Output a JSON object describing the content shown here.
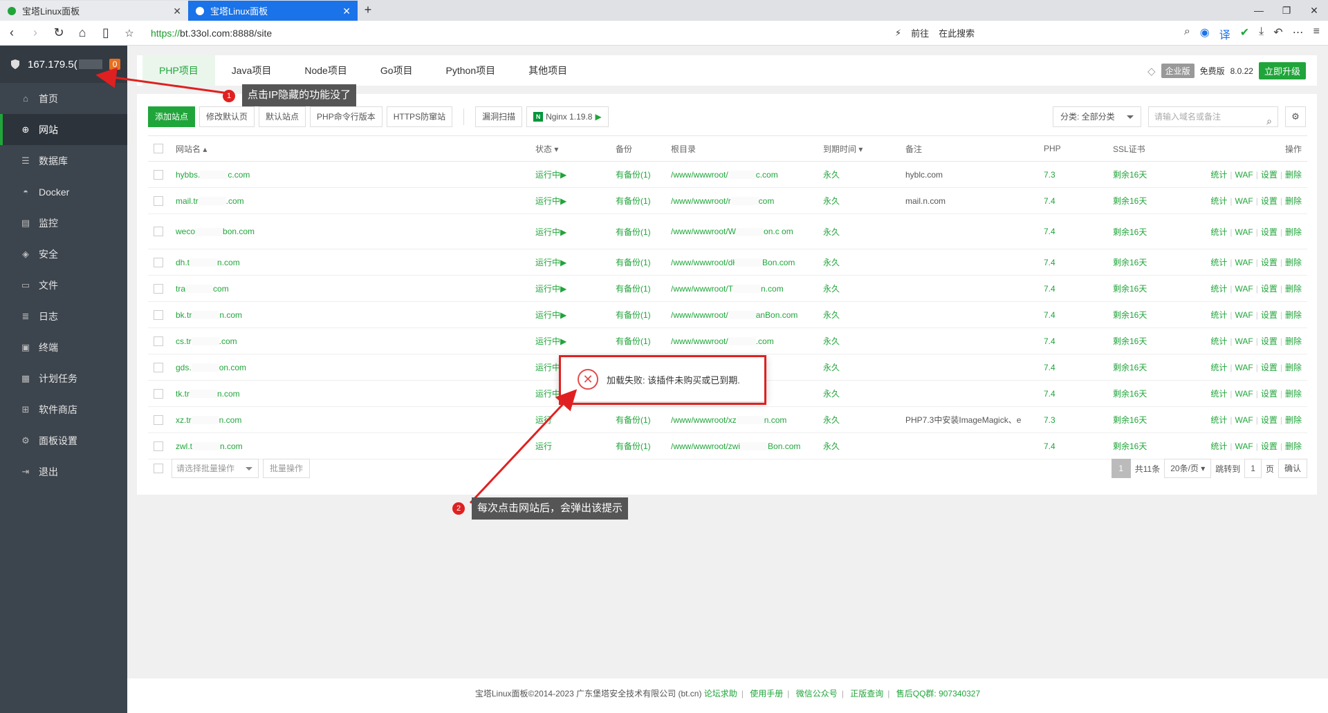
{
  "browser": {
    "tabs": [
      {
        "title": "宝塔Linux面板",
        "active": false
      },
      {
        "title": "宝塔Linux面板",
        "active": true
      }
    ],
    "url_scheme": "https://",
    "url_rest": "bt.33ol.com:8888/site",
    "go_label": "前往",
    "search_label": "在此搜索"
  },
  "sidebar": {
    "server_ip": "167.179.5(",
    "badge": "0",
    "items": [
      {
        "label": "首页",
        "icon": "home-icon"
      },
      {
        "label": "网站",
        "icon": "globe-icon",
        "active": true
      },
      {
        "label": "数据库",
        "icon": "database-icon"
      },
      {
        "label": "Docker",
        "icon": "docker-icon"
      },
      {
        "label": "监控",
        "icon": "monitor-icon"
      },
      {
        "label": "安全",
        "icon": "shield-icon"
      },
      {
        "label": "文件",
        "icon": "folder-icon"
      },
      {
        "label": "日志",
        "icon": "log-icon"
      },
      {
        "label": "终端",
        "icon": "terminal-icon"
      },
      {
        "label": "计划任务",
        "icon": "calendar-icon"
      },
      {
        "label": "软件商店",
        "icon": "grid-icon"
      },
      {
        "label": "面板设置",
        "icon": "gear-icon"
      },
      {
        "label": "退出",
        "icon": "logout-icon"
      }
    ]
  },
  "project_tabs": [
    "PHP项目",
    "Java项目",
    "Node项目",
    "Go项目",
    "Python项目",
    "其他项目"
  ],
  "header_right": {
    "enterprise": "企业版",
    "free": "免费版",
    "version": "8.0.22",
    "upgrade": "立即升级"
  },
  "toolbar": {
    "add_site": "添加站点",
    "edit_default_page": "修改默认页",
    "default_site": "默认站点",
    "php_cli_version": "PHP命令行版本",
    "https_guard": "HTTPS防窜站",
    "vuln_scan": "漏洞扫描",
    "nginx": "Nginx 1.19.8",
    "category": "分类: 全部分类",
    "search_placeholder": "请输入域名或备注"
  },
  "table": {
    "headers": {
      "name": "网站名",
      "status": "状态",
      "backup": "备份",
      "root": "根目录",
      "expire": "到期时间",
      "remark": "备注",
      "php": "PHP",
      "ssl": "SSL证书",
      "ops": "操作"
    },
    "ops": [
      "统计",
      "WAF",
      "设置",
      "删除"
    ],
    "rows": [
      {
        "name_a": "hybbs.",
        "name_b": "c.com",
        "status": "运行中▶",
        "backup": "有备份(1)",
        "root_a": "/www/wwwroot/",
        "root_b": "c.com",
        "expire": "永久",
        "remark_a": "hybl",
        "remark_b": "c.com",
        "php": "7.3",
        "ssl": "剩余16天"
      },
      {
        "name_a": "mail.tr",
        "name_b": ".com",
        "status": "运行中▶",
        "backup": "有备份(1)",
        "root_a": "/www/wwwroot/r",
        "root_b": "com",
        "expire": "永久",
        "remark_a": "mail.",
        "remark_b": "n.com",
        "php": "7.4",
        "ssl": "剩余16天"
      },
      {
        "name_a": "weco",
        "name_b": "bon.com",
        "status": "运行中▶",
        "backup": "有备份(1)",
        "root_a": "/www/wwwroot/W",
        "root_b": "on.c om",
        "expire": "永久",
        "remark_a": "",
        "remark_b": "",
        "php": "7.4",
        "ssl": "剩余16天",
        "tall": true
      },
      {
        "name_a": "dh.t",
        "name_b": "n.com",
        "status": "运行中▶",
        "backup": "有备份(1)",
        "root_a": "/www/wwwroot/dł",
        "root_b": "Bon.com",
        "expire": "永久",
        "remark_a": "",
        "remark_b": "",
        "php": "7.4",
        "ssl": "剩余16天"
      },
      {
        "name_a": "tra",
        "name_b": "com",
        "status": "运行中▶",
        "backup": "有备份(1)",
        "root_a": "/www/wwwroot/T",
        "root_b": "n.com",
        "expire": "永久",
        "remark_a": "",
        "remark_b": "",
        "php": "7.4",
        "ssl": "剩余16天"
      },
      {
        "name_a": "bk.tr",
        "name_b": "n.com",
        "status": "运行中▶",
        "backup": "有备份(1)",
        "root_a": "/www/wwwroot/",
        "root_b": "anBon.com",
        "expire": "永久",
        "remark_a": "",
        "remark_b": "",
        "php": "7.4",
        "ssl": "剩余16天"
      },
      {
        "name_a": "cs.tr",
        "name_b": ".com",
        "status": "运行中▶",
        "backup": "有备份(1)",
        "root_a": "/www/wwwroot/",
        "root_b": ".com",
        "expire": "永久",
        "remark_a": "",
        "remark_b": "",
        "php": "7.4",
        "ssl": "剩余16天"
      },
      {
        "name_a": "gds.",
        "name_b": "on.com",
        "status": "运行中",
        "backup": "",
        "root_a": "",
        "root_b": "n.com",
        "expire": "永久",
        "remark_a": "",
        "remark_b": "",
        "php": "7.4",
        "ssl": "剩余16天"
      },
      {
        "name_a": "tk.tr",
        "name_b": "n.com",
        "status": "运行中",
        "backup": "",
        "root_a": "",
        "root_b": "com",
        "expire": "永久",
        "remark_a": "",
        "remark_b": "",
        "php": "7.4",
        "ssl": "剩余16天"
      },
      {
        "name_a": "xz.tr",
        "name_b": "n.com",
        "status": "运行",
        "backup": "有备份(1)",
        "root_a": "/www/wwwroot/xz",
        "root_b": "n.com",
        "expire": "永久",
        "remark_a": "PHP7.3中安装ImageMagick、e",
        "remark_b": "",
        "php": "7.3",
        "ssl": "剩余16天"
      },
      {
        "name_a": "zwl.t",
        "name_b": "n.com",
        "status": "运行",
        "backup": "有备份(1)",
        "root_a": "/www/wwwroot/zwi",
        "root_b": "Bon.com",
        "expire": "永久",
        "remark_a": "",
        "remark_b": "",
        "php": "7.4",
        "ssl": "剩余16天"
      }
    ]
  },
  "batch": {
    "select_placeholder": "请选择批量操作",
    "button": "批量操作"
  },
  "pager": {
    "current": "1",
    "total": "共11条",
    "per_page": "20条/页",
    "jump_label": "跳转到",
    "jump_value": "1",
    "page_unit": "页",
    "confirm": "确认"
  },
  "toast": {
    "message": "加载失败: 该插件未购买或已到期."
  },
  "annotations": [
    {
      "num": "1",
      "text": "点击IP隐藏的功能没了"
    },
    {
      "num": "2",
      "text": "每次点击网站后，会弹出该提示"
    }
  ],
  "footer": {
    "copyright": "宝塔Linux面板©2014-2023 广东堡塔安全技术有限公司 (bt.cn)",
    "links": [
      "论坛求助",
      "使用手册",
      "微信公众号",
      "正版查询"
    ],
    "qq": "售后QQ群: 907340327"
  },
  "colors": {
    "green": "#20a53a",
    "sidebar": "#3c444d",
    "annot_red": "#e02020",
    "tab_blue": "#1a73e8"
  }
}
